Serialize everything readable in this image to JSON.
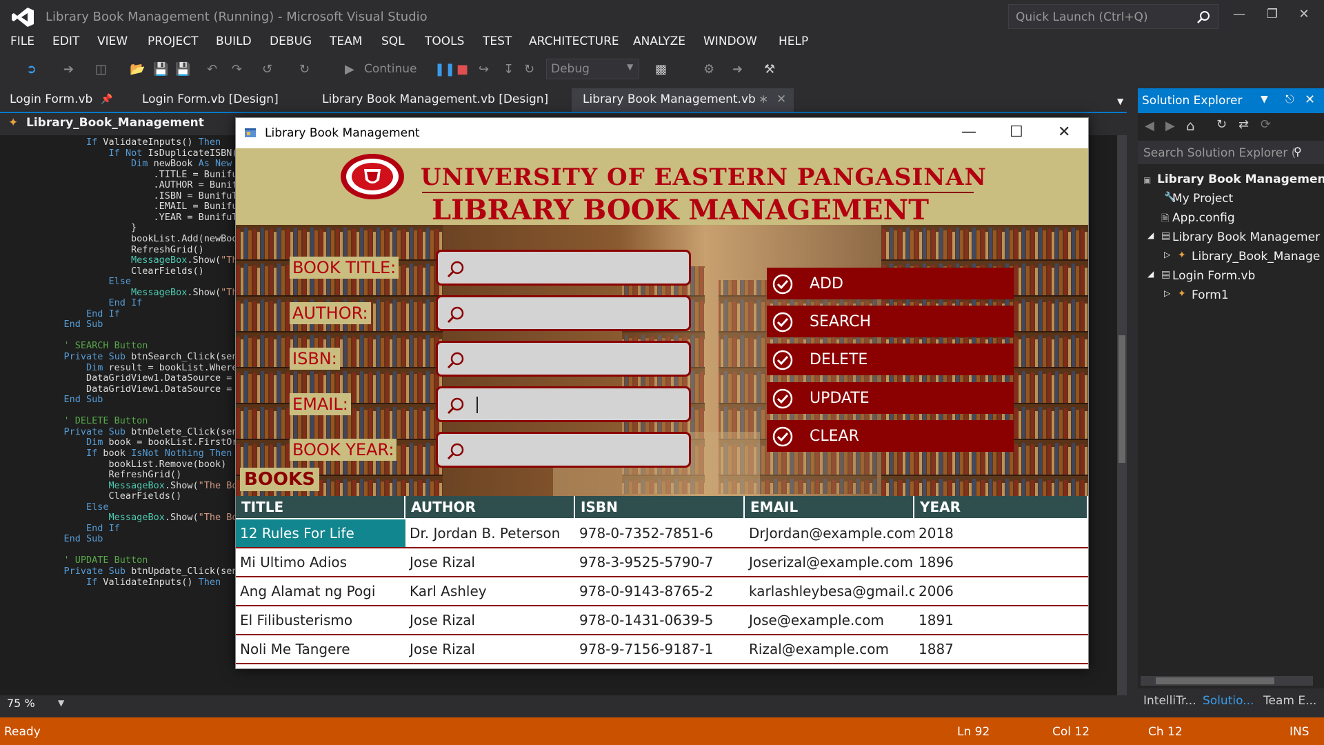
{
  "window": {
    "title": "Library Book Management (Running) - Microsoft Visual Studio",
    "quick_launch_placeholder": "Quick Launch (Ctrl+Q)"
  },
  "menu": [
    "FILE",
    "EDIT",
    "VIEW",
    "PROJECT",
    "BUILD",
    "DEBUG",
    "TEAM",
    "SQL",
    "TOOLS",
    "TEST",
    "ARCHITECTURE",
    "ANALYZE",
    "WINDOW",
    "HELP"
  ],
  "toolbar": {
    "continue_label": "Continue",
    "config_value": "Debug"
  },
  "doc_tabs": [
    "Login Form.vb",
    "Login Form.vb [Design]",
    "Library Book Management.vb [Design]",
    "Library Book Management.vb"
  ],
  "editor": {
    "nav_class": "Library_Book_Management",
    "zoom": "75 %",
    "code": [
      "        If ValidateInputs() Then",
      "            If Not IsDuplicateISBN(",
      "                Dim newBook As New",
      "                    .TITLE = Bunifu",
      "                    .AUTHOR = Bunif",
      "                    .ISBN = BunifuT",
      "                    .EMAIL = Bunifu",
      "                    .YEAR = BunifuT",
      "                }",
      "                bookList.Add(newBoo",
      "                RefreshGrid()",
      "                MessageBox.Show(\"Th",
      "                ClearFields()",
      "            Else",
      "                MessageBox.Show(\"Th",
      "            End If",
      "        End If",
      "    End Sub",
      "",
      "    ' SEARCH Button",
      "    Private Sub btnSearch_Click(sen",
      "        Dim result = bookList.Where",
      "        DataGridView1.DataSource =",
      "        DataGridView1.DataSource =",
      "    End Sub",
      "",
      "    ' DELETE Button",
      "    Private Sub btnDelete_Click(sen",
      "        Dim book = bookList.FirstOr",
      "        If book IsNot Nothing Then",
      "            bookList.Remove(book)",
      "            RefreshGrid()",
      "            MessageBox.Show(\"The Bo",
      "            ClearFields()",
      "        Else",
      "            MessageBox.Show(\"The Bo",
      "        End If",
      "    End Sub",
      "",
      "    ' UPDATE Button",
      "    Private Sub btnUpdate_Click(sender As Object, e As EventArgs) Handles BunifuFlatButton2.Click",
      "        If ValidateInputs() Then"
    ]
  },
  "solution_explorer": {
    "title": "Solution Explorer",
    "search_placeholder": "Search Solution Explorer (",
    "items": [
      "Library Book Management",
      "My Project",
      "App.config",
      "Library Book Managemer",
      "Library_Book_Manage",
      "Login Form.vb",
      "Form1"
    ],
    "bottom_tabs": [
      "IntelliTr...",
      "Solutio...",
      "Team E..."
    ]
  },
  "status": {
    "ready": "Ready",
    "ln": "Ln 92",
    "col": "Col 12",
    "ch": "Ch 12",
    "ins": "INS"
  },
  "form": {
    "title": "Library Book Management",
    "university": "UNIVERSITY   OF   EASTERN   PANGASINAN",
    "heading": "LIBRARY BOOK MANAGEMENT",
    "labels": [
      "BOOK TITLE:",
      "AUTHOR:",
      "ISBN:",
      "EMAIL:",
      "BOOK YEAR:"
    ],
    "buttons": [
      "ADD",
      "SEARCH",
      "DELETE",
      "UPDATE",
      "CLEAR"
    ],
    "books_label": "BOOKS",
    "grid": {
      "columns": [
        "TITLE",
        "AUTHOR",
        "ISBN",
        "EMAIL",
        "YEAR"
      ],
      "rows": [
        [
          "12 Rules For Life",
          "Dr. Jordan B. Peterson",
          "978-0-7352-7851-6",
          "DrJordan@example.com",
          "2018"
        ],
        [
          "Mi Ultimo Adios",
          "Jose Rizal",
          "978-3-9525-5790-7",
          "Joserizal@example.com",
          "1896"
        ],
        [
          "Ang Alamat ng Pogi",
          "Karl Ashley",
          "978-0-9143-8765-2",
          "karlashleybesa@gmail.c...",
          "2006"
        ],
        [
          "El Filibusterismo",
          "Jose Rizal",
          "978-0-1431-0639-5",
          "Jose@example.com",
          "1891"
        ],
        [
          "Noli Me Tangere",
          "Jose Rizal",
          "978-9-7156-9187-1",
          "Rizal@example.com",
          "1887"
        ]
      ]
    }
  }
}
